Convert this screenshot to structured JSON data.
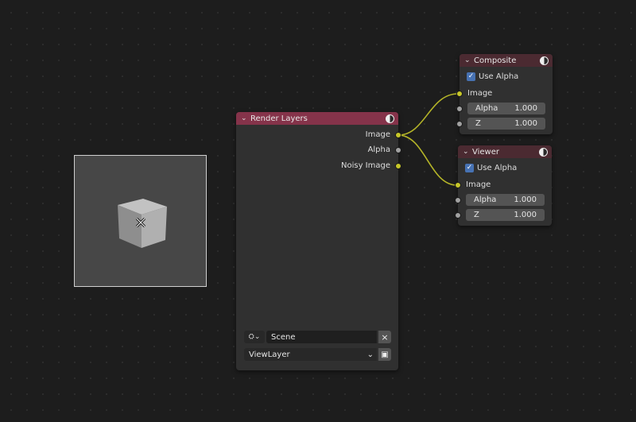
{
  "backdrop": {
    "cursor_icon": "move-cursor-icon"
  },
  "render_layers": {
    "title": "Render Layers",
    "outputs": [
      {
        "label": "Image",
        "socket": "yellow"
      },
      {
        "label": "Alpha",
        "socket": "grey"
      },
      {
        "label": "Noisy Image",
        "socket": "yellow"
      }
    ],
    "scene": {
      "value": "Scene",
      "clear_label": "×"
    },
    "view_layer": {
      "value": "ViewLayer"
    }
  },
  "composite": {
    "title": "Composite",
    "use_alpha_label": "Use Alpha",
    "use_alpha_checked": true,
    "image_label": "Image",
    "alpha_label": "Alpha",
    "alpha_value": "1.000",
    "z_label": "Z",
    "z_value": "1.000"
  },
  "viewer": {
    "title": "Viewer",
    "use_alpha_label": "Use Alpha",
    "use_alpha_checked": true,
    "image_label": "Image",
    "alpha_label": "Alpha",
    "alpha_value": "1.000",
    "z_label": "Z",
    "z_value": "1.000"
  },
  "colors": {
    "render_header": "#85334a",
    "output_header": "#4b2a31",
    "socket_yellow": "#c7c729",
    "socket_grey": "#a1a1a1",
    "link": "#b4b428",
    "checkbox": "#4772b3"
  }
}
